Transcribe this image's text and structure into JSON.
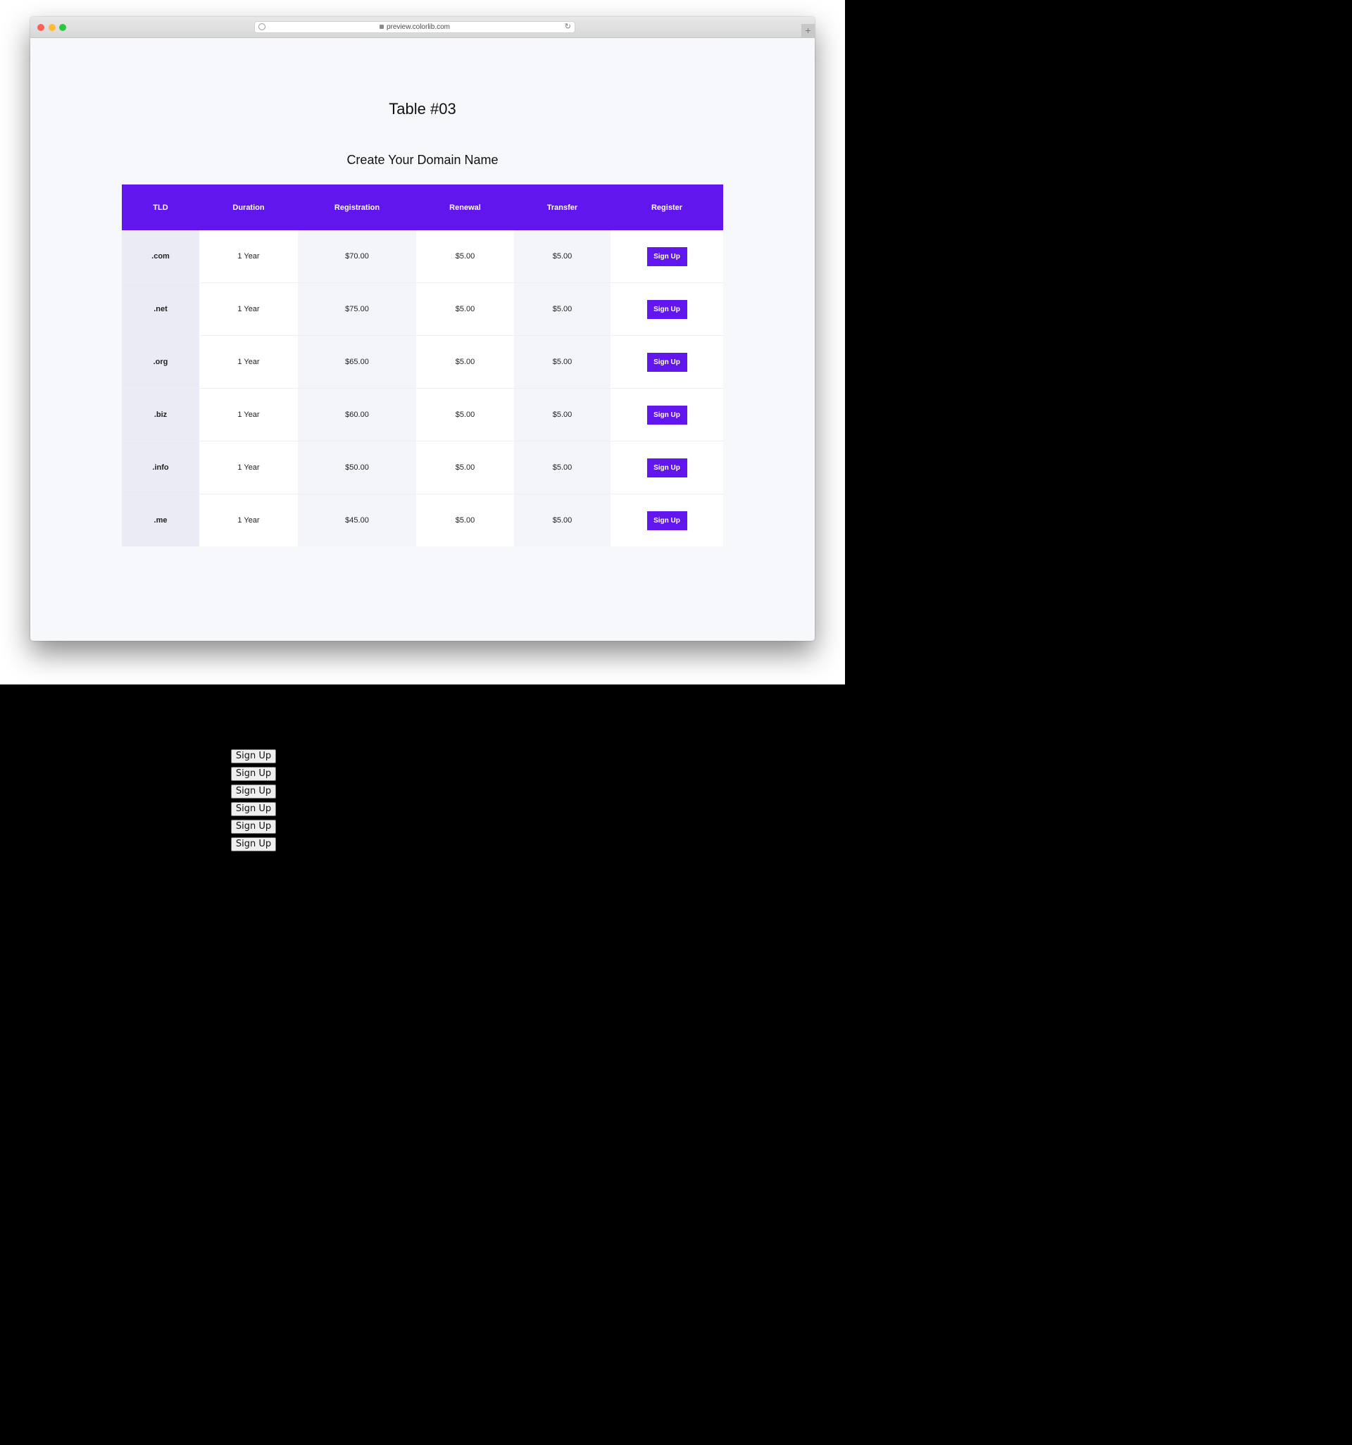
{
  "browser": {
    "url": "preview.colorlib.com",
    "reload_glyph": "↻",
    "new_tab_glyph": "+"
  },
  "page": {
    "title": "Table #03",
    "table_title": "Create Your Domain Name"
  },
  "table": {
    "headers": [
      "TLD",
      "Duration",
      "Registration",
      "Renewal",
      "Transfer",
      "Register"
    ],
    "rows": [
      {
        "tld": ".com",
        "duration": "1 Year",
        "registration": "$70.00",
        "renewal": "$5.00",
        "transfer": "$5.00",
        "button": "Sign Up"
      },
      {
        "tld": ".net",
        "duration": "1 Year",
        "registration": "$75.00",
        "renewal": "$5.00",
        "transfer": "$5.00",
        "button": "Sign Up"
      },
      {
        "tld": ".org",
        "duration": "1 Year",
        "registration": "$65.00",
        "renewal": "$5.00",
        "transfer": "$5.00",
        "button": "Sign Up"
      },
      {
        "tld": ".biz",
        "duration": "1 Year",
        "registration": "$60.00",
        "renewal": "$5.00",
        "transfer": "$5.00",
        "button": "Sign Up"
      },
      {
        "tld": ".info",
        "duration": "1 Year",
        "registration": "$50.00",
        "renewal": "$5.00",
        "transfer": "$5.00",
        "button": "Sign Up"
      },
      {
        "tld": ".me",
        "duration": "1 Year",
        "registration": "$45.00",
        "renewal": "$5.00",
        "transfer": "$5.00",
        "button": "Sign Up"
      }
    ]
  },
  "native_buttons": [
    "Sign Up",
    "Sign Up",
    "Sign Up",
    "Sign Up",
    "Sign Up",
    "Sign Up"
  ],
  "colors": {
    "accent": "#6116ee",
    "page_bg": "#f7f8fc",
    "outer_bg": "#000000"
  }
}
